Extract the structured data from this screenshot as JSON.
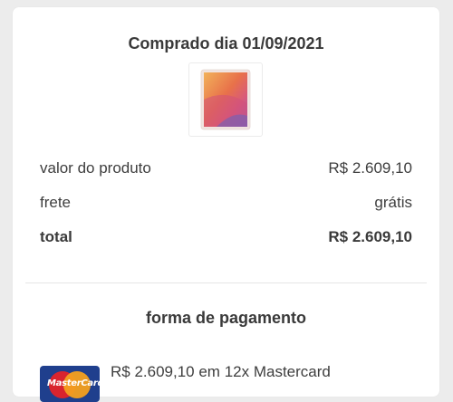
{
  "order": {
    "title": "Comprado dia 01/09/2021",
    "product_image": "ipad-thumbnail",
    "rows": [
      {
        "label": "valor do produto",
        "value": "R$ 2.609,10"
      },
      {
        "label": "frete",
        "value": "grátis"
      },
      {
        "label": "total",
        "value": "R$ 2.609,10"
      }
    ]
  },
  "payment": {
    "section_title": "forma de pagamento",
    "card_brand_text": "MasterCard",
    "card_icon": "mastercard-logo-icon",
    "summary": "R$ 2.609,10 em 12x Mastercard"
  },
  "colors": {
    "card_background": "#ffffff",
    "page_background": "#ececec",
    "text": "#333333"
  }
}
